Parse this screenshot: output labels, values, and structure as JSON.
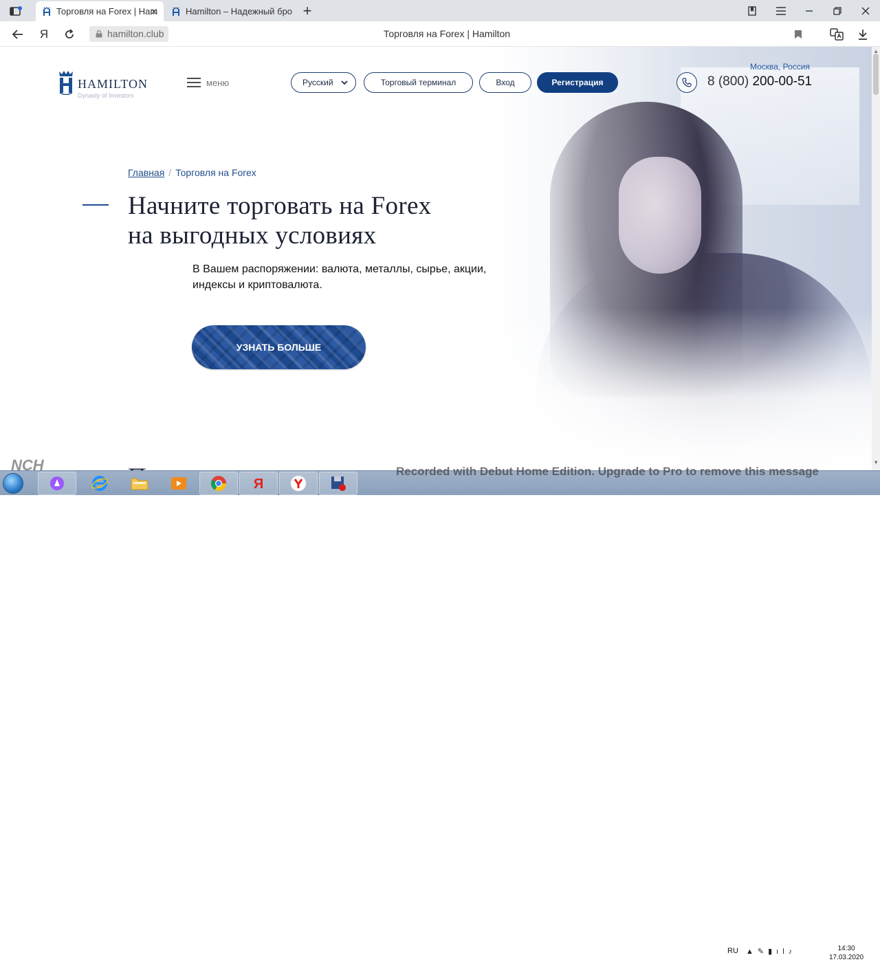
{
  "browser": {
    "tabs": [
      {
        "title": "Торговля на Forex | Ham",
        "active": true
      },
      {
        "title": "Hamilton – Надежный бро",
        "active": false
      }
    ],
    "new_tab": "+",
    "address": "hamilton.club",
    "page_title": "Торговля на Forex | Hamilton",
    "yandex_letter": "Я"
  },
  "site": {
    "logo": {
      "name": "HAMILTON",
      "tagline": "Dynasty of Investors"
    },
    "menu_label": "меню",
    "language": "Русский",
    "buttons": {
      "terminal": "Торговый терминал",
      "login": "Вход",
      "register": "Регистрация"
    },
    "contact": {
      "city": "Москва, Россия",
      "phone_prefix": "8 (800)",
      "phone_number": "200-00-51"
    },
    "breadcrumb": {
      "home": "Главная",
      "separator": "/",
      "current": "Торговля на Forex"
    },
    "headline_line1": "Начните торговать на Forex",
    "headline_line2": "на выгодных условиях",
    "subtext_line1": "В Вашем распоряжении: валюта, металлы, сырье, акции,",
    "subtext_line2": "индексы и криптовалюта.",
    "cta": "УЗНАТЬ БОЛЬШЕ",
    "next_heading_partial": "П"
  },
  "taskbar": {
    "recorder_logo": "NCH",
    "watermark": "Recorded with Debut Home Edition. Upgrade to Pro to remove this message",
    "language": "RU",
    "time": "14:30",
    "date": "17.03.2020",
    "apps": [
      "alice-app",
      "internet-explorer-app",
      "file-explorer-app",
      "media-player-app",
      "chrome-app",
      "yandex-app",
      "yandex-browser-app",
      "debut-recorder-app"
    ]
  },
  "colors": {
    "brand_blue": "#123f82",
    "link_blue": "#244f8f",
    "taskbar": "#8aa0bb"
  }
}
